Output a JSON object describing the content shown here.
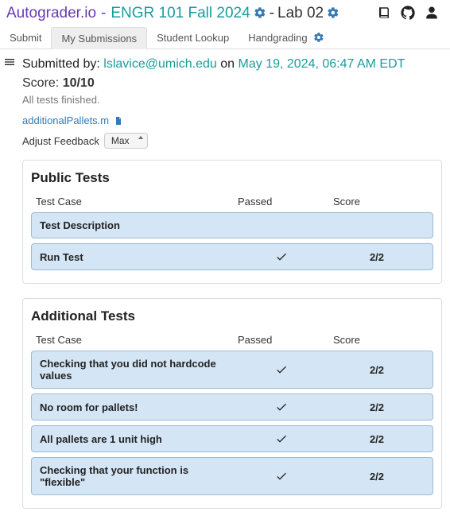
{
  "header": {
    "brand": "Autograder.io",
    "course": "ENGR 101 Fall 2024",
    "lab": "Lab 02"
  },
  "tabs": {
    "items": [
      {
        "label": "Submit"
      },
      {
        "label": "My Submissions"
      },
      {
        "label": "Student Lookup"
      },
      {
        "label": "Handgrading"
      }
    ]
  },
  "submission": {
    "submitted_by_label": "Submitted by: ",
    "submitted_by": "lslavice@umich.edu",
    "on_label": " on ",
    "submitted_on": "May 19, 2024, 06:47 AM EDT",
    "score_label": "Score: ",
    "score": "10/10",
    "status": "All tests finished.",
    "file": "additionalPallets.m",
    "feedback_label": "Adjust Feedback",
    "feedback_value": "Max"
  },
  "sections": [
    {
      "title": "Public Tests",
      "head": {
        "c1": "Test Case",
        "c2": "Passed",
        "c3": "Score"
      },
      "rows": [
        {
          "name": "Test Description",
          "passed": false,
          "score": ""
        },
        {
          "name": "Run Test",
          "passed": true,
          "score": "2/2"
        }
      ]
    },
    {
      "title": "Additional Tests",
      "head": {
        "c1": "Test Case",
        "c2": "Passed",
        "c3": "Score"
      },
      "rows": [
        {
          "name": "Checking that you did not hardcode values",
          "passed": true,
          "score": "2/2"
        },
        {
          "name": "No room for pallets!",
          "passed": true,
          "score": "2/2"
        },
        {
          "name": "All pallets are 1 unit high",
          "passed": true,
          "score": "2/2"
        },
        {
          "name": "Checking that your function is \"flexible\"",
          "passed": true,
          "score": "2/2"
        }
      ]
    }
  ]
}
